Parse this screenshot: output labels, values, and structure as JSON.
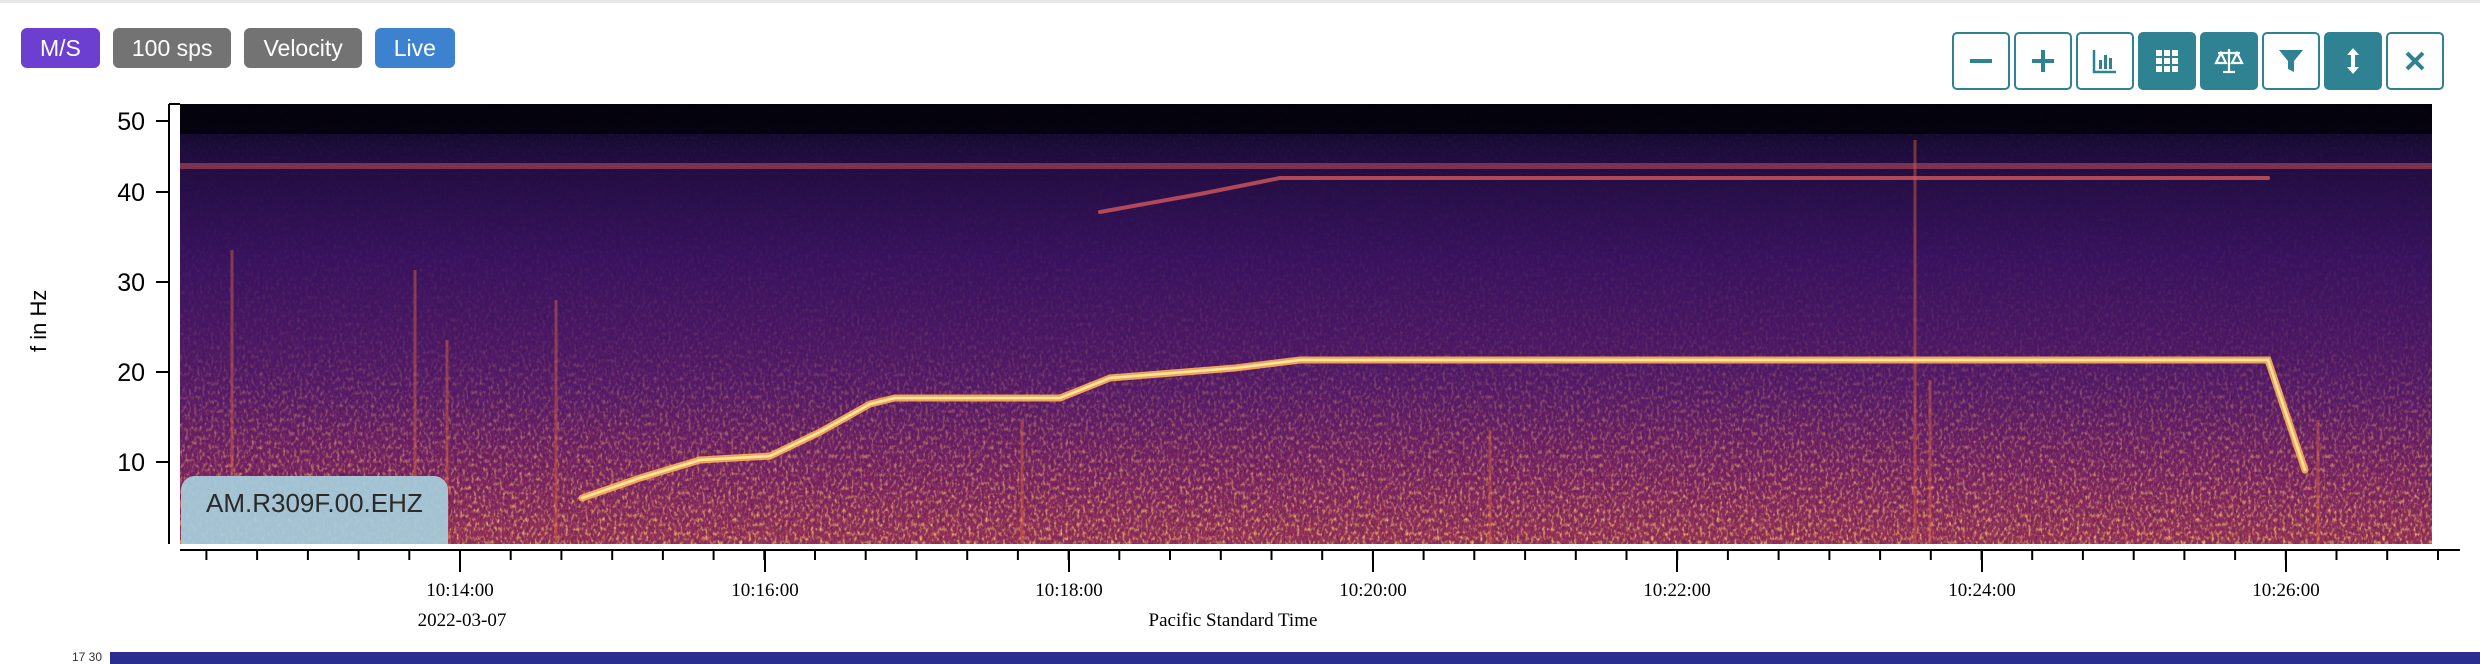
{
  "badges": [
    {
      "label": "M/S",
      "color": "#6c3fd0"
    },
    {
      "label": "100 sps",
      "color": "#737373"
    },
    {
      "label": "Velocity",
      "color": "#737373"
    },
    {
      "label": "Live",
      "color": "#3d82cf"
    }
  ],
  "toolbar": {
    "buttons": [
      {
        "name": "zoom-out-button",
        "icon": "minus-icon",
        "style": "outline"
      },
      {
        "name": "zoom-in-button",
        "icon": "plus-icon",
        "style": "outline"
      },
      {
        "name": "histogram-button",
        "icon": "bar-chart-icon",
        "style": "outline"
      },
      {
        "name": "grid-button",
        "icon": "grid-icon",
        "style": "filled"
      },
      {
        "name": "scale-button",
        "icon": "balance-scale-icon",
        "style": "filled"
      },
      {
        "name": "filter-button",
        "icon": "filter-icon",
        "style": "outline"
      },
      {
        "name": "vertical-expand-button",
        "icon": "arrows-vertical-icon",
        "style": "filled"
      },
      {
        "name": "close-button",
        "icon": "close-icon",
        "style": "outline"
      }
    ]
  },
  "plot": {
    "ylabel": "f in Hz",
    "y_ticks": [
      "10",
      "20",
      "30",
      "40",
      "50"
    ],
    "x_ticks": [
      "10:14:00",
      "10:16:00",
      "10:18:00",
      "10:20:00",
      "10:22:00",
      "10:24:00",
      "10:26:00"
    ],
    "date_label": "2022-03-07",
    "xlabel": "Pacific Standard Time",
    "station": "AM.R309F.00.EHZ",
    "colormap": "inferno"
  },
  "footer": {
    "partial_text": "17 30"
  }
}
